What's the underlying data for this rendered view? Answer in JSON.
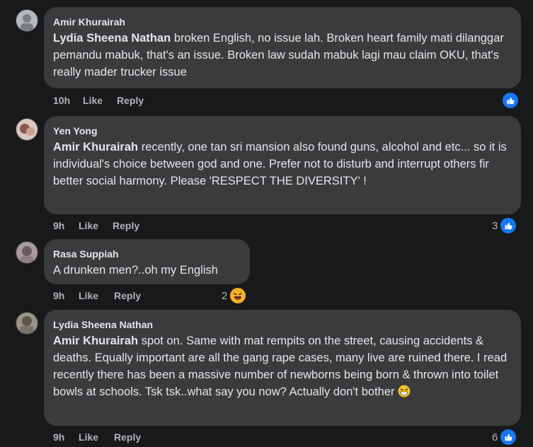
{
  "comments": [
    {
      "author": "Amir Khurairah",
      "mention": "Lydia Sheena Nathan",
      "text": " broken English, no issue lah. Broken heart family mati dilanggar pemandu mabuk, that's an issue. Broken law sudah mabuk lagi mau claim OKU, that's really mader trucker issue",
      "time": "10h",
      "like": "Like",
      "reply": "Reply",
      "reaction_count": ""
    },
    {
      "author": "Yen Yong",
      "mention": "Amir Khurairah",
      "text": " recently, one tan sri mansion also found guns, alcohol and etc... so it is individual's choice between god and one. Prefer not to disturb and interrupt others fir better social harmony. Please 'RESPECT THE DIVERSITY' !",
      "time": "9h",
      "like": "Like",
      "reply": "Reply",
      "reaction_count": "3"
    },
    {
      "author": "Rasa Suppiah",
      "mention": "",
      "text": "A drunken men?..oh my English",
      "time": "9h",
      "like": "Like",
      "reply": "Reply",
      "reaction_count": "2"
    },
    {
      "author": "Lydia Sheena Nathan",
      "mention": "Amir Khurairah",
      "text": " spot on. Same with mat rempits on the street, causing accidents & deaths. Equally important are all the gang rape cases, many live are ruined there. I read recently there has been a massive number of newborns being born & thrown into toilet bowls at schools. Tsk tsk..what say you now? Actually don't bother",
      "time": "9h",
      "like": "Like",
      "reply": "Reply",
      "reaction_count": "6"
    }
  ],
  "icons": {
    "like": "thumbs-up-icon",
    "haha": "laughing-emoji-icon"
  },
  "colors": {
    "background": "#18191a",
    "bubble": "#3a3b3c",
    "like_blue": "#1877f2"
  }
}
